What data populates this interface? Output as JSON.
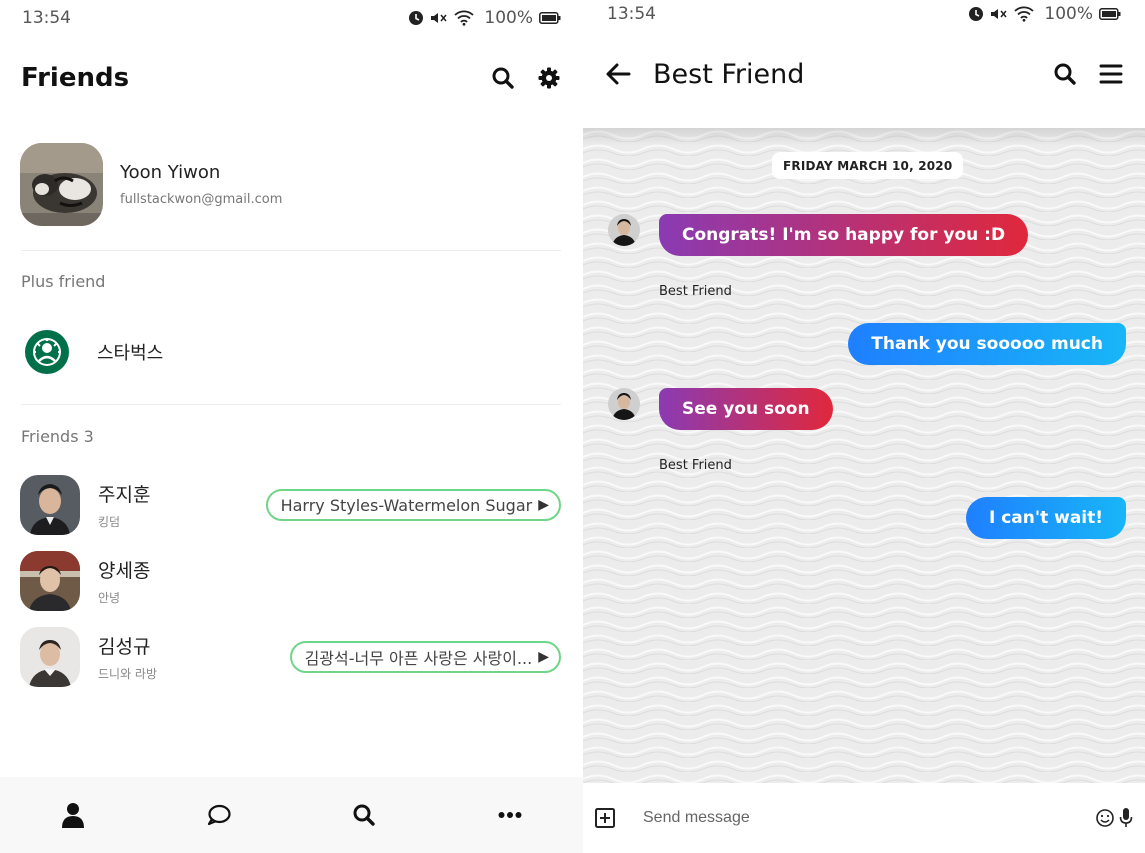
{
  "left": {
    "status_bar": {
      "time": "13:54",
      "battery": "100%"
    },
    "header": {
      "title": "Friends",
      "icons": [
        "search-icon",
        "gear-icon"
      ]
    },
    "profile": {
      "name": "Yoon Yiwon",
      "email": "fullstackwon@gmail.com"
    },
    "plus_friend": {
      "section_label": "Plus friend",
      "items": [
        {
          "name": "스타벅스"
        }
      ]
    },
    "friends": {
      "section_label": "Friends 3",
      "items": [
        {
          "name": "주지훈",
          "status": "킹덤",
          "music": "Harry Styles-Watermelon Sugar"
        },
        {
          "name": "양세종",
          "status": "안녕",
          "music": ""
        },
        {
          "name": "김성규",
          "status": "드니와 라방",
          "music": "김광석-너무 아픈 사랑은 사랑이..."
        }
      ]
    },
    "bottom_nav": [
      "person-icon",
      "chat-bubble-icon",
      "search-icon",
      "more-icon"
    ]
  },
  "right": {
    "status_bar": {
      "time": "13:54",
      "battery": "100%"
    },
    "header": {
      "title": "Best Friend"
    },
    "date": "FRIDAY MARCH 10, 2020",
    "messages": [
      {
        "direction": "in",
        "text": "Congrats! I'm so happy for you :D",
        "sender": "Best Friend"
      },
      {
        "direction": "out",
        "text": "Thank you sooooo much"
      },
      {
        "direction": "in",
        "text": "See you soon",
        "sender": "Best Friend"
      },
      {
        "direction": "out",
        "text": "I can't wait!"
      }
    ],
    "input": {
      "placeholder": "Send message"
    }
  },
  "colors": {
    "incoming_gradient": [
      "#8a3bb3",
      "#e0283c"
    ],
    "outgoing_gradient": [
      "#1f7fff",
      "#18b6f7"
    ],
    "music_pill_border": "#6fd689",
    "starbucks_green": "#00704a"
  }
}
